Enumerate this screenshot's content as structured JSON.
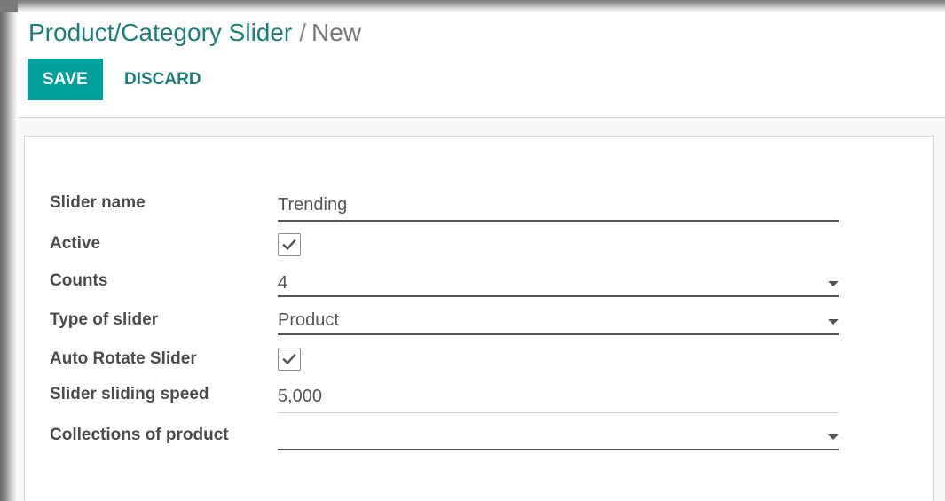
{
  "breadcrumb": {
    "parent": "Product/Category Slider",
    "separator": "/",
    "current": "New"
  },
  "buttons": {
    "save": "SAVE",
    "discard": "DISCARD"
  },
  "form": {
    "slider_name": {
      "label": "Slider name",
      "value": "Trending"
    },
    "active": {
      "label": "Active",
      "checked": true
    },
    "counts": {
      "label": "Counts",
      "value": "4"
    },
    "type_of_slider": {
      "label": "Type of slider",
      "value": "Product"
    },
    "auto_rotate": {
      "label": "Auto Rotate Slider",
      "checked": true
    },
    "sliding_speed": {
      "label": "Slider sliding speed",
      "value": "5,000"
    },
    "collections": {
      "label": "Collections of product",
      "value": ""
    }
  },
  "colors": {
    "primary": "#00a09d",
    "link": "#1f7d7d"
  },
  "icons": {
    "checkbox_mark": "checkmark-icon",
    "dropdown": "caret-down-icon"
  }
}
